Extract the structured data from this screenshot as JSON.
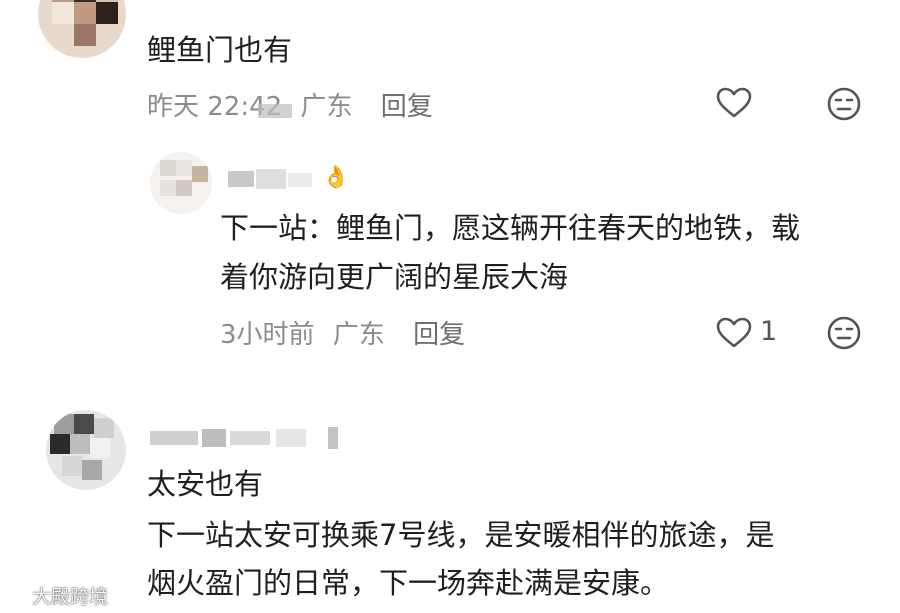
{
  "comments": [
    {
      "text": "鲤鱼门也有",
      "time": "昨天 22:42",
      "location": "广东",
      "reply_label": "回复"
    },
    {
      "text_line1": "下一站：鲤鱼门，愿这辆开往春天的地铁，载",
      "text_line2": "着你游向更广阔的星辰大海",
      "time": "3小时前",
      "location": "广东",
      "reply_label": "回复",
      "like_count": "1",
      "emoji": "👌"
    },
    {
      "title": "太安也有",
      "text_line1": "下一站太安可换乘7号线，是安暖相伴的旅途，是",
      "text_line2": "烟火盈门的日常，下一场奔赴满是安康。"
    }
  ],
  "watermark": {
    "text": "大殿跨境",
    "logo_icon": "circle-logo-icon"
  },
  "colors": {
    "text": "#1f1f1f",
    "meta": "#8c8c8c",
    "icon": "#555555"
  }
}
